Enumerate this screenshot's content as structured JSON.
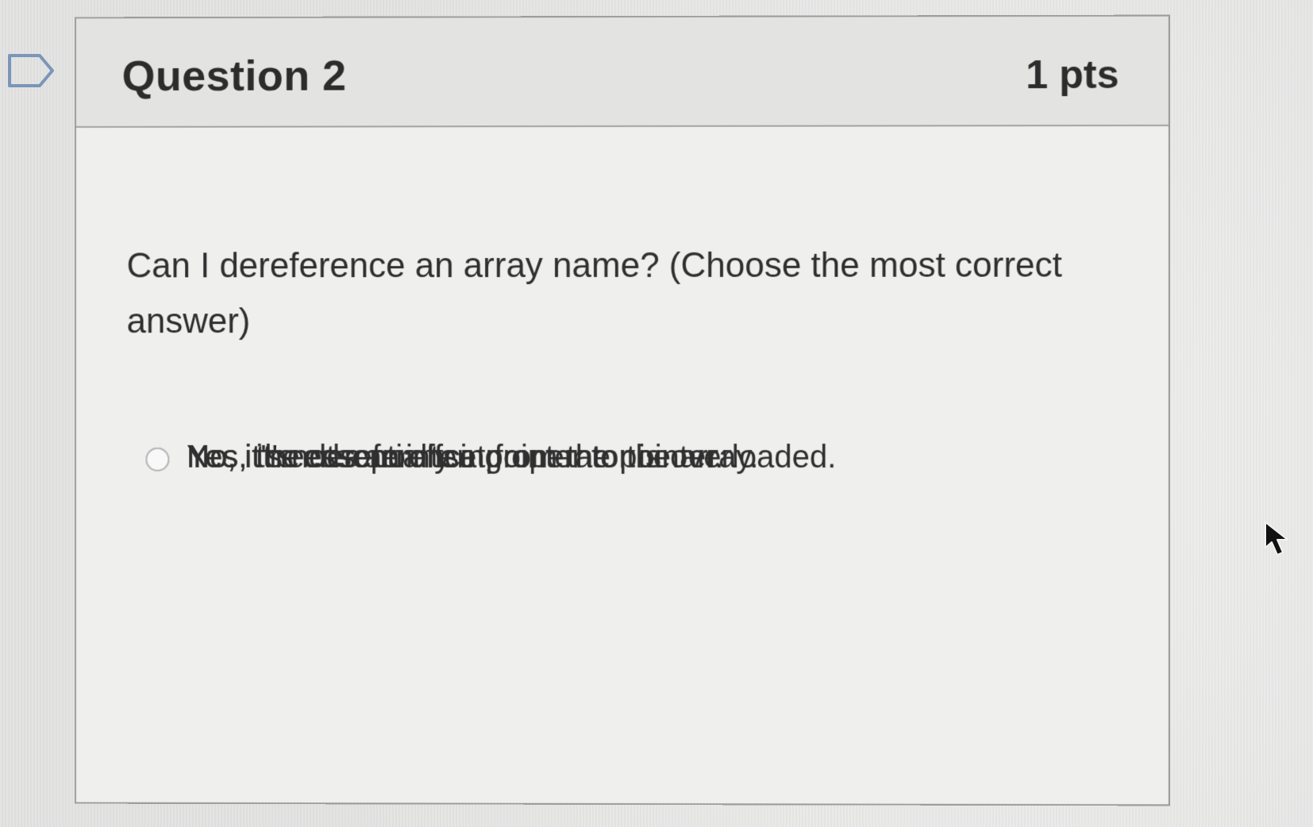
{
  "question": {
    "title": "Question 2",
    "points": "1 pts",
    "text": "Can I dereference an array name? (Choose the most correct answer)"
  },
  "answers": [
    "No, it needs an offset from the pointer.",
    "Yes, the dereferencing operator is overloaded.",
    "Yes, it's essentially a pointer to the array.",
    "No, it's not a pointer."
  ],
  "colors": {
    "page_background": "#e9e9e8",
    "card_background": "#efefee",
    "header_background": "#e3e3e2",
    "border": "#9c9c9c",
    "text": "#2f2f2f"
  },
  "icons": {
    "flag": "flag-icon",
    "radio": "radio-icon",
    "cursor": "mouse-cursor-icon"
  }
}
